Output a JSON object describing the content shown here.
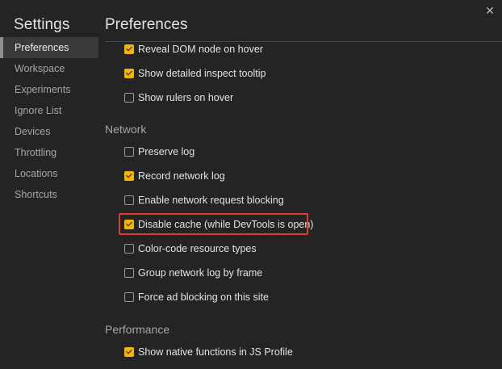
{
  "sidebar": {
    "title": "Settings",
    "items": [
      {
        "label": "Preferences",
        "active": true
      },
      {
        "label": "Workspace",
        "active": false
      },
      {
        "label": "Experiments",
        "active": false
      },
      {
        "label": "Ignore List",
        "active": false
      },
      {
        "label": "Devices",
        "active": false
      },
      {
        "label": "Throttling",
        "active": false
      },
      {
        "label": "Locations",
        "active": false
      },
      {
        "label": "Shortcuts",
        "active": false
      }
    ]
  },
  "main": {
    "title": "Preferences",
    "close_icon": "close-icon",
    "elements_options": [
      {
        "label": "Reveal DOM node on hover",
        "checked": true
      },
      {
        "label": "Show detailed inspect tooltip",
        "checked": true
      },
      {
        "label": "Show rulers on hover",
        "checked": false
      }
    ],
    "network": {
      "title": "Network",
      "options": [
        {
          "label": "Preserve log",
          "checked": false
        },
        {
          "label": "Record network log",
          "checked": true
        },
        {
          "label": "Enable network request blocking",
          "checked": false
        },
        {
          "label": "Disable cache (while DevTools is open)",
          "checked": true,
          "highlighted": true
        },
        {
          "label": "Color-code resource types",
          "checked": false
        },
        {
          "label": "Group network log by frame",
          "checked": false
        },
        {
          "label": "Force ad blocking on this site",
          "checked": false
        }
      ]
    },
    "performance": {
      "title": "Performance",
      "options": [
        {
          "label": "Show native functions in JS Profile",
          "checked": true
        }
      ]
    }
  },
  "colors": {
    "accent": "#f4b400",
    "highlight": "#e03c2e",
    "background": "#242424"
  }
}
